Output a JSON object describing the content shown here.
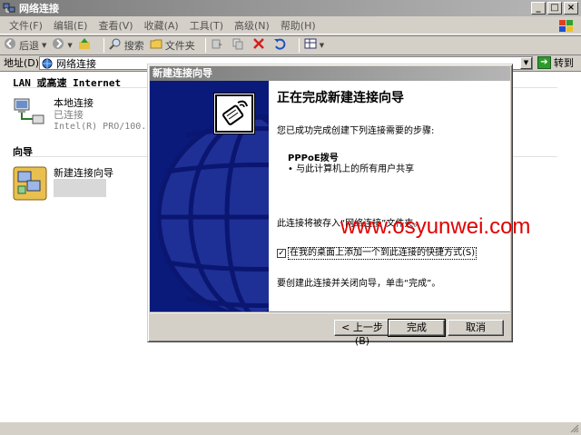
{
  "window": {
    "title": "网络连接",
    "caption_buttons": [
      "_",
      "□",
      "×"
    ]
  },
  "menubar": {
    "items": [
      "文件(F)",
      "编辑(E)",
      "查看(V)",
      "收藏(A)",
      "工具(T)",
      "高级(N)",
      "帮助(H)"
    ]
  },
  "toolbar": {
    "back_label": "后退",
    "search_label": "搜索",
    "folders_label": "文件夹"
  },
  "address": {
    "label": "地址(D)",
    "value": "网络连接",
    "go_label": "转到"
  },
  "content": {
    "group1_header": "LAN 或高速 Internet",
    "local_connection": {
      "name": "本地连接",
      "status": "已连接",
      "device": "Intel(R) PRO/100..."
    },
    "group2_header": "向导",
    "new_connection_wizard": {
      "name": "新建连接向导"
    }
  },
  "wizard": {
    "title": "新建连接向导",
    "heading": "正在完成新建连接向导",
    "intro": "您已成功完成创建下列连接需要的步骤:",
    "connection_name": "PPPoE拨号",
    "bullet": "• 与此计算机上的所有用户共享",
    "save_note": "此连接将被存入“网络连接”文件夹。",
    "shortcut_label": "在我的桌面上添加一个到此连接的快捷方式(S)",
    "shortcut_checked": "✓",
    "finish_note": "要创建此连接并关闭向导，单击“完成”。",
    "back_button": "< 上一步(B)",
    "finish_button": "完成",
    "cancel_button": "取消"
  },
  "watermark": "www.osyunwei.com",
  "colors": {
    "wizard_art_bg": "#0a1a7a",
    "watermark": "#e00000",
    "title_gradient_start": "#7b7b7b"
  }
}
